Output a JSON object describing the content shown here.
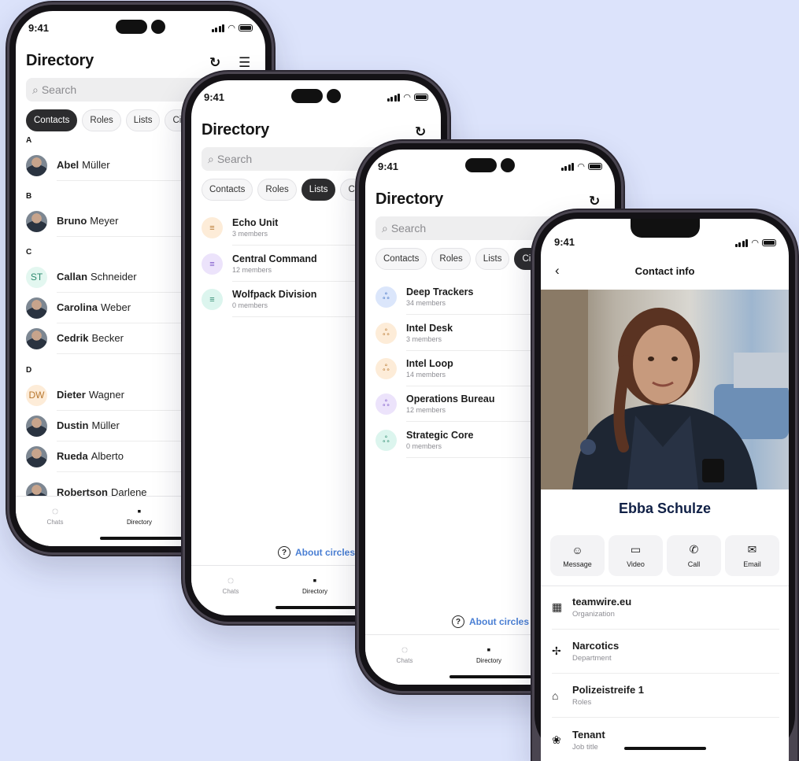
{
  "status": {
    "time": "9:41"
  },
  "directory": {
    "title": "Directory",
    "search_placeholder": "Search",
    "tabs": [
      "Contacts",
      "Roles",
      "Lists",
      "Circ"
    ],
    "contacts": [
      {
        "section": "A"
      },
      {
        "first": "Abel",
        "last": "Müller",
        "avatar": "photo"
      },
      {
        "section": "B"
      },
      {
        "first": "Bruno",
        "last": "Meyer",
        "avatar": "photo"
      },
      {
        "section": "C"
      },
      {
        "first": "Callan",
        "last": "Schneider",
        "avatar": "initials",
        "initials": "ST"
      },
      {
        "first": "Carolina",
        "last": "Weber",
        "avatar": "photo"
      },
      {
        "first": "Cedrik",
        "last": "Becker",
        "avatar": "photo"
      },
      {
        "section": "D"
      },
      {
        "first": "Dieter",
        "last": "Wagner",
        "avatar": "initials",
        "initials": "DW"
      },
      {
        "first": "Dustin",
        "last": "Müller",
        "avatar": "photo"
      },
      {
        "first": "Rueda",
        "last": "Alberto",
        "avatar": "photo"
      },
      {
        "first": "Robertson",
        "last": "Darlene",
        "avatar": "photo"
      }
    ],
    "lists": [
      {
        "name": "Echo Unit",
        "members": "3 members"
      },
      {
        "name": "Central Command",
        "members": "12 members"
      },
      {
        "name": "Wolfpack Division",
        "members": "0 members"
      }
    ],
    "circles": [
      {
        "name": "Deep Trackers",
        "members": "34 members"
      },
      {
        "name": "Intel Desk",
        "members": "3 members"
      },
      {
        "name": "Intel Loop",
        "members": "14 members"
      },
      {
        "name": "Operations Bureau",
        "members": "12 members"
      },
      {
        "name": "Strategic Core",
        "members": "0 members"
      }
    ],
    "about_circles": "About circles"
  },
  "tabbar": {
    "chats": "Chats",
    "directory": "Directory"
  },
  "contact_info": {
    "title": "Contact info",
    "name": "Ebba Schulze",
    "actions": [
      "Message",
      "Video",
      "Call",
      "Email"
    ],
    "fields": [
      {
        "value": "teamwire.eu",
        "label": "Organization"
      },
      {
        "value": "Narcotics",
        "label": "Department"
      },
      {
        "value": "Polizeistreife 1",
        "label": "Roles"
      },
      {
        "value": "Tenant",
        "label": "Job title"
      }
    ]
  },
  "colors": {
    "background": "#dce3fb",
    "link": "#4a7fd4",
    "name": "#102046"
  }
}
